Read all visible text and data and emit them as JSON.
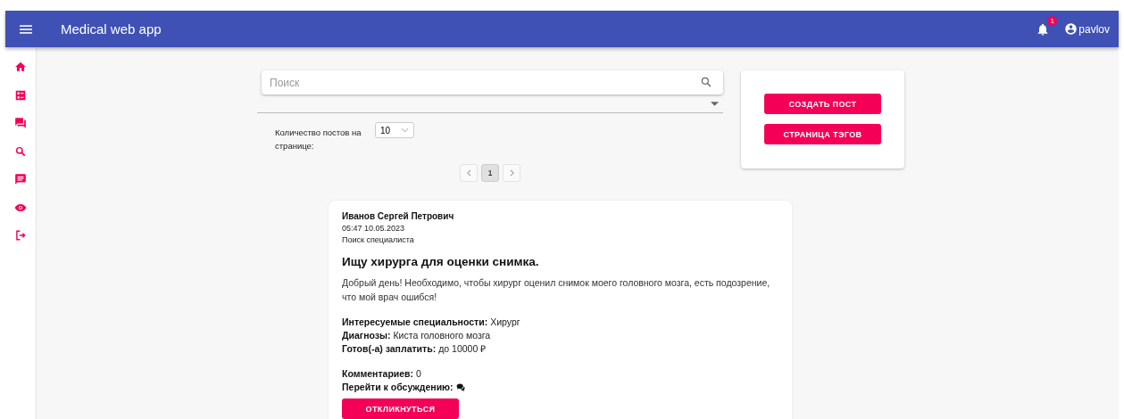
{
  "app_bar": {
    "title": "Medical web app",
    "notifications_badge": "1",
    "user": "pavlov"
  },
  "search": {
    "placeholder": "Поиск"
  },
  "per_page": {
    "label": "Количество постов на странице:",
    "value": "10"
  },
  "pagination": {
    "pages": [
      {
        "label": "1",
        "selected": true
      }
    ]
  },
  "actions": [
    "СОЗДАТЬ ПОСТ",
    "СТРАНИЦА ТЭГОВ"
  ],
  "post": {
    "author": "Иванов Сергей Петрович",
    "date": "05:47 10.05.2023",
    "category": "Поиск специалиста",
    "title": "Ищу хирурга для оценки снимка.",
    "body": "Добрый день! Необходимо, чтобы хирург оценил снимок моего головного мозга, есть подозрение, что мой врач ошибся!",
    "fields": [
      {
        "label": "Интересуемые специальности:",
        "value": "Хирург"
      },
      {
        "label": "Диагнозы:",
        "value": "Киста головного мозга"
      },
      {
        "label": "Готов(-а) заплатить:",
        "value": "до 10000 ₽"
      }
    ],
    "comments": {
      "label": "Комментариев:",
      "value": "0"
    },
    "discussion_label": "Перейти к обсуждению:",
    "respond_button": "ОТКЛИКНУТЬСЯ"
  }
}
